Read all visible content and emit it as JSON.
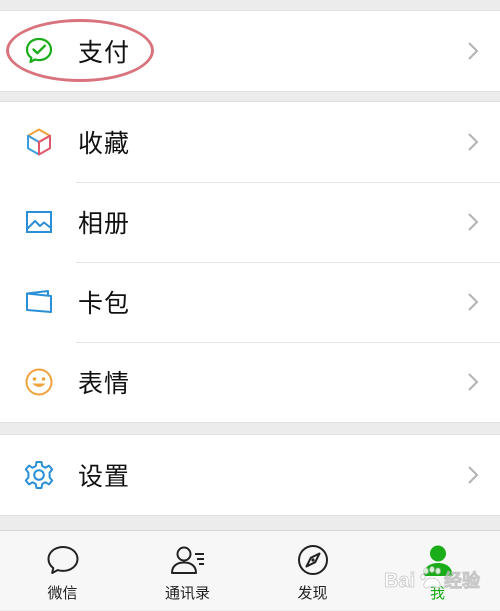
{
  "colors": {
    "accent_green": "#1aad19",
    "highlight_oval": "#d9747f",
    "chevron": "#b2b2b2",
    "background": "#ececec"
  },
  "groups": [
    {
      "items": [
        {
          "key": "pay",
          "label": "支付",
          "icon": "wechat-pay-icon",
          "highlighted": true
        }
      ]
    },
    {
      "items": [
        {
          "key": "favorites",
          "label": "收藏",
          "icon": "cube-icon"
        },
        {
          "key": "album",
          "label": "相册",
          "icon": "photo-icon"
        },
        {
          "key": "cards",
          "label": "卡包",
          "icon": "card-wallet-icon"
        },
        {
          "key": "stickers",
          "label": "表情",
          "icon": "smiley-icon"
        }
      ]
    },
    {
      "items": [
        {
          "key": "settings",
          "label": "设置",
          "icon": "gear-icon"
        }
      ]
    }
  ],
  "tabbar": {
    "active": "me",
    "tabs": [
      {
        "key": "chats",
        "label": "微信",
        "icon": "chat-bubble-icon"
      },
      {
        "key": "contacts",
        "label": "通讯录",
        "icon": "contacts-icon"
      },
      {
        "key": "discover",
        "label": "发现",
        "icon": "compass-icon"
      },
      {
        "key": "me",
        "label": "我",
        "icon": "person-icon"
      }
    ]
  },
  "watermark": {
    "text": "Bai 经验",
    "kind": "logo"
  }
}
